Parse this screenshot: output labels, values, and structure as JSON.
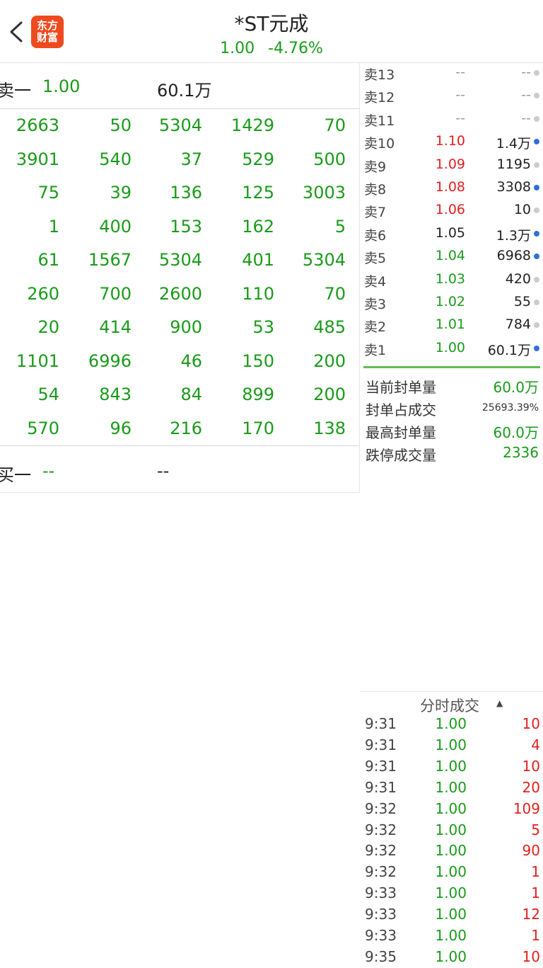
{
  "header": {
    "logo_line1": "东方",
    "logo_line2": "财富",
    "title": "*ST元成",
    "price": "1.00",
    "change_pct": "-4.76%"
  },
  "left_panel": {
    "sell_row": {
      "label": "卖一",
      "price": "1.00",
      "volume": "60.1万"
    },
    "buy_row": {
      "label": "买一",
      "price": "--",
      "volume": "--"
    },
    "queue": [
      [
        "2663",
        "50",
        "5304",
        "1429",
        "70"
      ],
      [
        "3901",
        "540",
        "37",
        "529",
        "500"
      ],
      [
        "75",
        "39",
        "136",
        "125",
        "3003"
      ],
      [
        "1",
        "400",
        "153",
        "162",
        "5"
      ],
      [
        "61",
        "1567",
        "5304",
        "401",
        "5304"
      ],
      [
        "260",
        "700",
        "2600",
        "110",
        "70"
      ],
      [
        "20",
        "414",
        "900",
        "53",
        "485"
      ],
      [
        "1101",
        "6996",
        "46",
        "150",
        "200"
      ],
      [
        "54",
        "843",
        "84",
        "899",
        "200"
      ],
      [
        "570",
        "96",
        "216",
        "170",
        "138"
      ]
    ]
  },
  "order_book": [
    {
      "label": "卖13",
      "price": "--",
      "volume": "--",
      "price_color": "#999999",
      "dot": "#cccccc"
    },
    {
      "label": "卖12",
      "price": "--",
      "volume": "--",
      "price_color": "#999999",
      "dot": "#cccccc"
    },
    {
      "label": "卖11",
      "price": "--",
      "volume": "--",
      "price_color": "#999999",
      "dot": "#cccccc"
    },
    {
      "label": "卖10",
      "price": "1.10",
      "volume": "1.4万",
      "price_color": "#e02020",
      "dot": "#2f6fd6"
    },
    {
      "label": "卖9",
      "price": "1.09",
      "volume": "1195",
      "price_color": "#e02020",
      "dot": "#cccccc"
    },
    {
      "label": "卖8",
      "price": "1.08",
      "volume": "3308",
      "price_color": "#e02020",
      "dot": "#2f6fd6"
    },
    {
      "label": "卖7",
      "price": "1.06",
      "volume": "10",
      "price_color": "#e02020",
      "dot": "#cccccc"
    },
    {
      "label": "卖6",
      "price": "1.05",
      "volume": "1.3万",
      "price_color": "#222222",
      "dot": "#2f6fd6"
    },
    {
      "label": "卖5",
      "price": "1.04",
      "volume": "6968",
      "price_color": "#1a9a1a",
      "dot": "#2f6fd6"
    },
    {
      "label": "卖4",
      "price": "1.03",
      "volume": "420",
      "price_color": "#1a9a1a",
      "dot": "#cccccc"
    },
    {
      "label": "卖3",
      "price": "1.02",
      "volume": "55",
      "price_color": "#1a9a1a",
      "dot": "#cccccc"
    },
    {
      "label": "卖2",
      "price": "1.01",
      "volume": "784",
      "price_color": "#1a9a1a",
      "dot": "#cccccc"
    },
    {
      "label": "卖1",
      "price": "1.00",
      "volume": "60.1万",
      "price_color": "#1a9a1a",
      "dot": "#2f6fd6"
    }
  ],
  "stats": [
    {
      "label": "当前封单量",
      "value": "60.0万"
    },
    {
      "label": "封单占成交",
      "value": "25693.39%"
    },
    {
      "label": "最高封单量",
      "value": "60.0万"
    },
    {
      "label": "跌停成交量",
      "value": "2336"
    }
  ],
  "time_sales": {
    "title": "分时成交",
    "caret": "▲",
    "rows": [
      {
        "time": "9:31",
        "price": "1.00",
        "volume": "10"
      },
      {
        "time": "9:31",
        "price": "1.00",
        "volume": "4"
      },
      {
        "time": "9:31",
        "price": "1.00",
        "volume": "10"
      },
      {
        "time": "9:31",
        "price": "1.00",
        "volume": "20"
      },
      {
        "time": "9:32",
        "price": "1.00",
        "volume": "109"
      },
      {
        "time": "9:32",
        "price": "1.00",
        "volume": "5"
      },
      {
        "time": "9:32",
        "price": "1.00",
        "volume": "90"
      },
      {
        "time": "9:32",
        "price": "1.00",
        "volume": "1"
      },
      {
        "time": "9:33",
        "price": "1.00",
        "volume": "1"
      },
      {
        "time": "9:33",
        "price": "1.00",
        "volume": "12"
      },
      {
        "time": "9:33",
        "price": "1.00",
        "volume": "1"
      },
      {
        "time": "9:35",
        "price": "1.00",
        "volume": "10"
      }
    ]
  }
}
